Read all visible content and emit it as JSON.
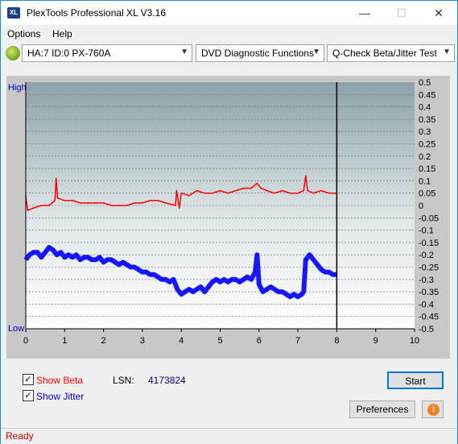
{
  "window": {
    "title": "PlexTools Professional XL V3.16",
    "icon_text": "XL"
  },
  "menu": {
    "items": [
      "Options",
      "Help"
    ]
  },
  "toolbar": {
    "drive": "HA:7 ID:0  PX-760A",
    "function": "DVD Diagnostic Functions",
    "test": "Q-Check Beta/Jitter Test"
  },
  "chart_data": {
    "type": "line",
    "left_axis": {
      "top_label": "High",
      "bottom_label": "Low"
    },
    "x_ticks": [
      "0",
      "1",
      "2",
      "3",
      "4",
      "5",
      "6",
      "7",
      "8",
      "9",
      "10"
    ],
    "xlim": [
      0,
      10
    ],
    "right_ticks": [
      "0.5",
      "0.45",
      "0.4",
      "0.35",
      "0.3",
      "0.25",
      "0.2",
      "0.15",
      "0.1",
      "0.05",
      "0",
      "-0.05",
      "-0.1",
      "-0.15",
      "-0.2",
      "-0.25",
      "-0.3",
      "-0.35",
      "-0.4",
      "-0.45",
      "-0.5"
    ],
    "ylim": [
      -0.5,
      0.5
    ],
    "end_marker_x": 8.0,
    "series": [
      {
        "color": "#ff0000",
        "points": [
          [
            0,
            0.04
          ],
          [
            0.05,
            -0.02
          ],
          [
            0.2,
            -0.01
          ],
          [
            0.4,
            0.0
          ],
          [
            0.6,
            0.0
          ],
          [
            0.75,
            0.02
          ],
          [
            0.78,
            0.11
          ],
          [
            0.82,
            0.03
          ],
          [
            1.0,
            0.02
          ],
          [
            1.2,
            0.02
          ],
          [
            1.4,
            0.01
          ],
          [
            1.6,
            0.01
          ],
          [
            1.8,
            0.01
          ],
          [
            2.0,
            0.01
          ],
          [
            2.2,
            0.0
          ],
          [
            2.4,
            0.0
          ],
          [
            2.6,
            0.0
          ],
          [
            2.8,
            0.01
          ],
          [
            3.0,
            0.01
          ],
          [
            3.2,
            0.02
          ],
          [
            3.4,
            0.02
          ],
          [
            3.6,
            0.01
          ],
          [
            3.85,
            0.0
          ],
          [
            3.88,
            0.06
          ],
          [
            3.95,
            -0.01
          ],
          [
            4.0,
            0.05
          ],
          [
            4.2,
            0.04
          ],
          [
            4.4,
            0.06
          ],
          [
            4.6,
            0.05
          ],
          [
            4.8,
            0.05
          ],
          [
            5.0,
            0.06
          ],
          [
            5.2,
            0.05
          ],
          [
            5.4,
            0.06
          ],
          [
            5.6,
            0.07
          ],
          [
            5.8,
            0.07
          ],
          [
            5.95,
            0.09
          ],
          [
            6.05,
            0.07
          ],
          [
            6.2,
            0.06
          ],
          [
            6.4,
            0.05
          ],
          [
            6.6,
            0.06
          ],
          [
            6.8,
            0.05
          ],
          [
            7.0,
            0.05
          ],
          [
            7.15,
            0.06
          ],
          [
            7.2,
            0.12
          ],
          [
            7.25,
            0.06
          ],
          [
            7.4,
            0.05
          ],
          [
            7.6,
            0.06
          ],
          [
            7.8,
            0.05
          ],
          [
            8.0,
            0.05
          ]
        ]
      },
      {
        "color": "#0000ff",
        "points": [
          [
            0,
            -0.22
          ],
          [
            0.1,
            -0.2
          ],
          [
            0.2,
            -0.19
          ],
          [
            0.3,
            -0.19
          ],
          [
            0.4,
            -0.21
          ],
          [
            0.5,
            -0.19
          ],
          [
            0.6,
            -0.17
          ],
          [
            0.7,
            -0.18
          ],
          [
            0.8,
            -0.2
          ],
          [
            0.9,
            -0.19
          ],
          [
            1.0,
            -0.21
          ],
          [
            1.1,
            -0.2
          ],
          [
            1.2,
            -0.21
          ],
          [
            1.3,
            -0.2
          ],
          [
            1.4,
            -0.22
          ],
          [
            1.5,
            -0.21
          ],
          [
            1.6,
            -0.21
          ],
          [
            1.7,
            -0.22
          ],
          [
            1.8,
            -0.22
          ],
          [
            1.9,
            -0.21
          ],
          [
            2.0,
            -0.23
          ],
          [
            2.1,
            -0.22
          ],
          [
            2.2,
            -0.22
          ],
          [
            2.3,
            -0.23
          ],
          [
            2.4,
            -0.24
          ],
          [
            2.5,
            -0.23
          ],
          [
            2.6,
            -0.24
          ],
          [
            2.7,
            -0.25
          ],
          [
            2.8,
            -0.25
          ],
          [
            2.9,
            -0.26
          ],
          [
            3.0,
            -0.27
          ],
          [
            3.1,
            -0.27
          ],
          [
            3.2,
            -0.28
          ],
          [
            3.3,
            -0.28
          ],
          [
            3.4,
            -0.29
          ],
          [
            3.5,
            -0.3
          ],
          [
            3.6,
            -0.3
          ],
          [
            3.7,
            -0.31
          ],
          [
            3.8,
            -0.3
          ],
          [
            3.9,
            -0.34
          ],
          [
            4.0,
            -0.36
          ],
          [
            4.1,
            -0.35
          ],
          [
            4.2,
            -0.34
          ],
          [
            4.3,
            -0.35
          ],
          [
            4.4,
            -0.34
          ],
          [
            4.5,
            -0.33
          ],
          [
            4.6,
            -0.35
          ],
          [
            4.7,
            -0.33
          ],
          [
            4.8,
            -0.31
          ],
          [
            4.9,
            -0.3
          ],
          [
            5.0,
            -0.31
          ],
          [
            5.1,
            -0.3
          ],
          [
            5.2,
            -0.31
          ],
          [
            5.3,
            -0.3
          ],
          [
            5.4,
            -0.3
          ],
          [
            5.5,
            -0.31
          ],
          [
            5.6,
            -0.3
          ],
          [
            5.7,
            -0.29
          ],
          [
            5.8,
            -0.3
          ],
          [
            5.9,
            -0.27
          ],
          [
            5.95,
            -0.2
          ],
          [
            6.0,
            -0.32
          ],
          [
            6.1,
            -0.35
          ],
          [
            6.2,
            -0.34
          ],
          [
            6.3,
            -0.33
          ],
          [
            6.4,
            -0.34
          ],
          [
            6.5,
            -0.35
          ],
          [
            6.6,
            -0.35
          ],
          [
            6.7,
            -0.36
          ],
          [
            6.8,
            -0.37
          ],
          [
            6.9,
            -0.36
          ],
          [
            7.0,
            -0.37
          ],
          [
            7.1,
            -0.36
          ],
          [
            7.15,
            -0.35
          ],
          [
            7.2,
            -0.22
          ],
          [
            7.3,
            -0.2
          ],
          [
            7.4,
            -0.22
          ],
          [
            7.5,
            -0.24
          ],
          [
            7.6,
            -0.26
          ],
          [
            7.7,
            -0.27
          ],
          [
            7.8,
            -0.27
          ],
          [
            7.9,
            -0.28
          ],
          [
            8.0,
            -0.28
          ]
        ]
      }
    ]
  },
  "options": {
    "show_beta_label": "Show Beta",
    "show_jitter_label": "Show Jitter",
    "show_beta_checked": true,
    "show_jitter_checked": true,
    "beta_color": "#ff0000",
    "jitter_color": "#0000cc"
  },
  "lsn": {
    "label": "LSN:",
    "value": "4173824"
  },
  "buttons": {
    "start": "Start",
    "preferences": "Preferences",
    "info_icon": "info-icon"
  },
  "status": {
    "text": "Ready",
    "color": "#c00000"
  }
}
